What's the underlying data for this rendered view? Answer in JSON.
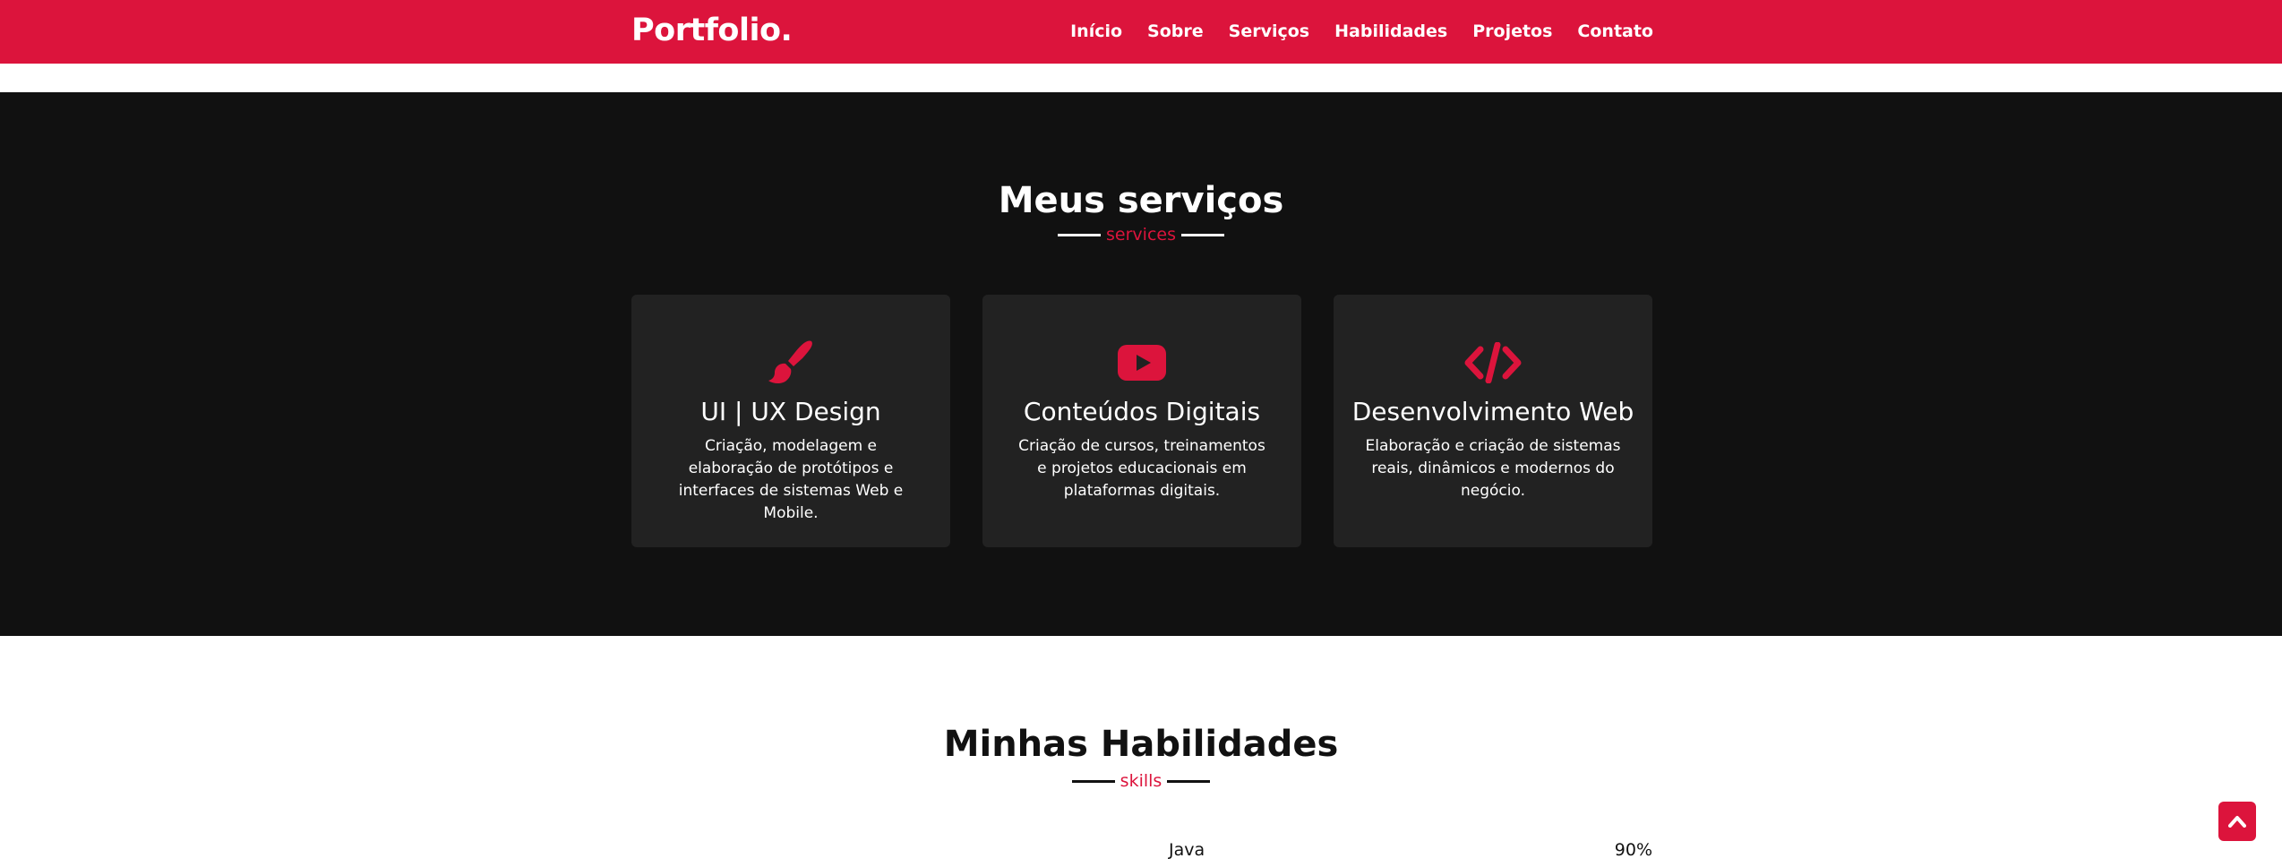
{
  "navbar": {
    "logo": "Portfolio.",
    "links": [
      "Início",
      "Sobre",
      "Serviços",
      "Habilidades",
      "Projetos",
      "Contato"
    ]
  },
  "services": {
    "title": "Meus serviços",
    "subtitle": "services",
    "cards": [
      {
        "icon": "paintbrush-icon",
        "title": "UI | UX Design",
        "text": "Criação, modelagem e elaboração de protótipos e interfaces de sistemas Web e Mobile."
      },
      {
        "icon": "youtube-icon",
        "title": "Conteúdos Digitais",
        "text": "Criação de cursos, treinamentos e projetos educacionais em plataformas digitais."
      },
      {
        "icon": "code-icon",
        "title": "Desenvolvimento Web",
        "text": "Elaboração e criação de sistemas reais, dinâmicos e modernos do negócio."
      }
    ]
  },
  "skills": {
    "title": "Minhas Habilidades",
    "subtitle": "skills",
    "items": [
      {
        "name": "Java",
        "percent": "90%"
      }
    ]
  },
  "colors": {
    "accent": "#dc143c",
    "dark": "#111111",
    "card": "#222222"
  }
}
